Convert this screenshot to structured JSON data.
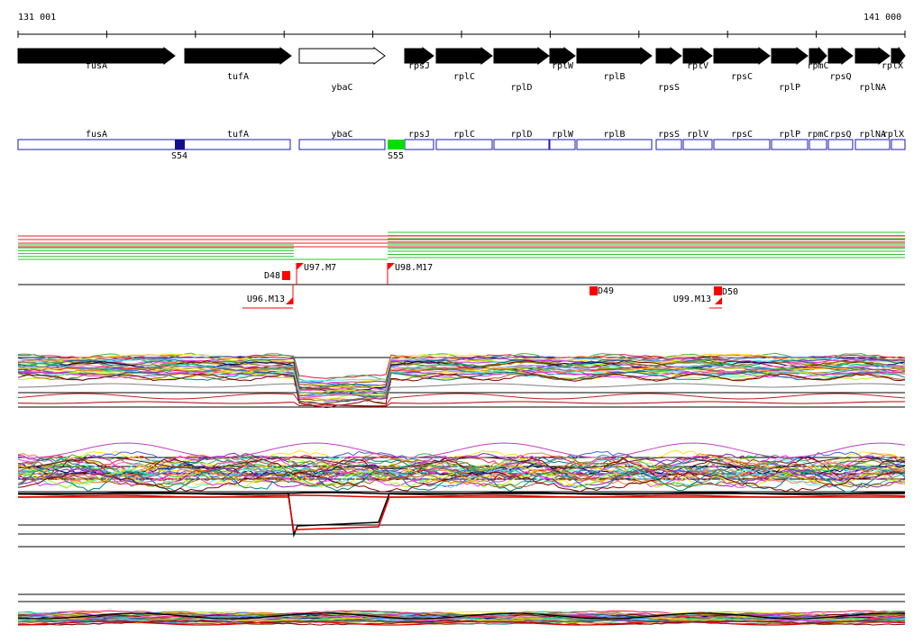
{
  "coordinates": {
    "start": "131 001",
    "end": "141 000"
  },
  "track_colors": {
    "arrow": "#000000",
    "outline": "#1a1ab4",
    "axis": "#000000",
    "site_dark": "#10108c",
    "site_green": "#00e000",
    "marker": "#ff0000"
  },
  "genes": [
    {
      "name": "fusA",
      "strand": "+",
      "filled": true
    },
    {
      "name": "tufA",
      "strand": "+",
      "filled": true
    },
    {
      "name": "ybaC",
      "strand": "+",
      "filled": false
    },
    {
      "name": "rpsJ",
      "strand": "+",
      "filled": true
    },
    {
      "name": "rplC",
      "strand": "+",
      "filled": true
    },
    {
      "name": "rplD",
      "strand": "+",
      "filled": true
    },
    {
      "name": "rplW",
      "strand": "+",
      "filled": true
    },
    {
      "name": "rplB",
      "strand": "+",
      "filled": true
    },
    {
      "name": "rpsS",
      "strand": "+",
      "filled": true
    },
    {
      "name": "rplV",
      "strand": "+",
      "filled": true
    },
    {
      "name": "rpsC",
      "strand": "+",
      "filled": true
    },
    {
      "name": "rplP",
      "strand": "+",
      "filled": true
    },
    {
      "name": "rpmC",
      "strand": "+",
      "filled": true
    },
    {
      "name": "rpsQ",
      "strand": "+",
      "filled": true
    },
    {
      "name": "rplNA",
      "strand": "+",
      "filled": true
    },
    {
      "name": "rplX",
      "strand": "+",
      "filled": true
    }
  ],
  "sites": [
    {
      "label": "S54",
      "color": "#10108c"
    },
    {
      "label": "S55",
      "color": "#00e000"
    }
  ],
  "probes": [
    {
      "label": "D48",
      "kind": "deletion"
    },
    {
      "label": "U97.M7",
      "kind": "flag"
    },
    {
      "label": "U98.M17",
      "kind": "flag"
    },
    {
      "label": "U96.M13",
      "kind": "flag"
    },
    {
      "label": "D49",
      "kind": "deletion"
    },
    {
      "label": "U99.M13",
      "kind": "flag"
    },
    {
      "label": "D50",
      "kind": "deletion"
    }
  ],
  "profile_palette": [
    "#e6194b",
    "#3cb44b",
    "#ffe119",
    "#4363d8",
    "#f58231",
    "#911eb4",
    "#46f0f0",
    "#f032e6",
    "#bcf60c",
    "#008080",
    "#9a6324",
    "#800000",
    "#808000",
    "#000075",
    "#ff66cc",
    "#00cc66",
    "#6699ff",
    "#cc9900"
  ]
}
